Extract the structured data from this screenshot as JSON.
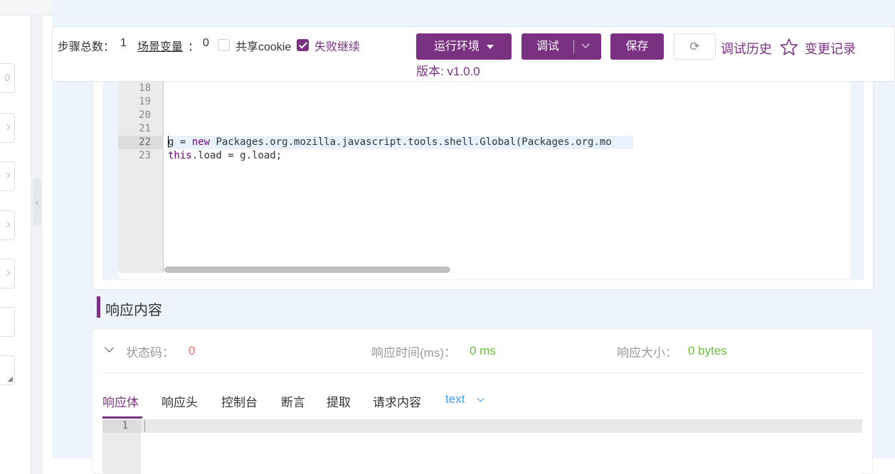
{
  "toolbar": {
    "step_count_label": "步骤总数：",
    "step_count_value": "1",
    "scene_vars_label": "场景变量",
    "scene_vars_sep": "：",
    "scene_vars_value": "0",
    "share_cookie_label": "共享cookie",
    "share_cookie_checked": false,
    "continue_on_fail_label": "失败继续",
    "continue_on_fail_checked": true,
    "env_button_label": "运行环境",
    "debug_button_label": "调试",
    "save_button_label": "保存",
    "refresh_icon": "refresh-icon",
    "debug_history_label": "调试历史",
    "star_icon": "star-icon",
    "change_log_label": "变更记录",
    "version_label": "版本: v1.0.0",
    "accent_color": "#7b3182"
  },
  "left_panel": {
    "field_0_value": "0"
  },
  "editor": {
    "lines": [
      {
        "no": "18",
        "code": ""
      },
      {
        "no": "19",
        "code": ""
      },
      {
        "no": "20",
        "code": ""
      },
      {
        "no": "21",
        "code": ""
      },
      {
        "no": "22",
        "code_prefix": "g = ",
        "code_kw": "new",
        "code_rest": " Packages.org.mozilla.javascript.tools.shell.Global(Packages.org.mo",
        "active": true
      },
      {
        "no": "23",
        "code_kw": "this",
        "code_rest": ".load = g.load;"
      }
    ]
  },
  "response": {
    "section_title": "响应内容",
    "status_label": "状态码：",
    "status_value": "0",
    "time_label": "响应时间(ms)：",
    "time_value": "0 ms",
    "size_label": "响应大小：",
    "size_value": "0 bytes",
    "tabs": [
      "响应体",
      "响应头",
      "控制台",
      "断言",
      "提取",
      "请求内容"
    ],
    "active_tab": "响应体",
    "format_select": "text",
    "body_line_no": "1",
    "status_color": "#f56c6c",
    "ok_color": "#67c23a"
  }
}
